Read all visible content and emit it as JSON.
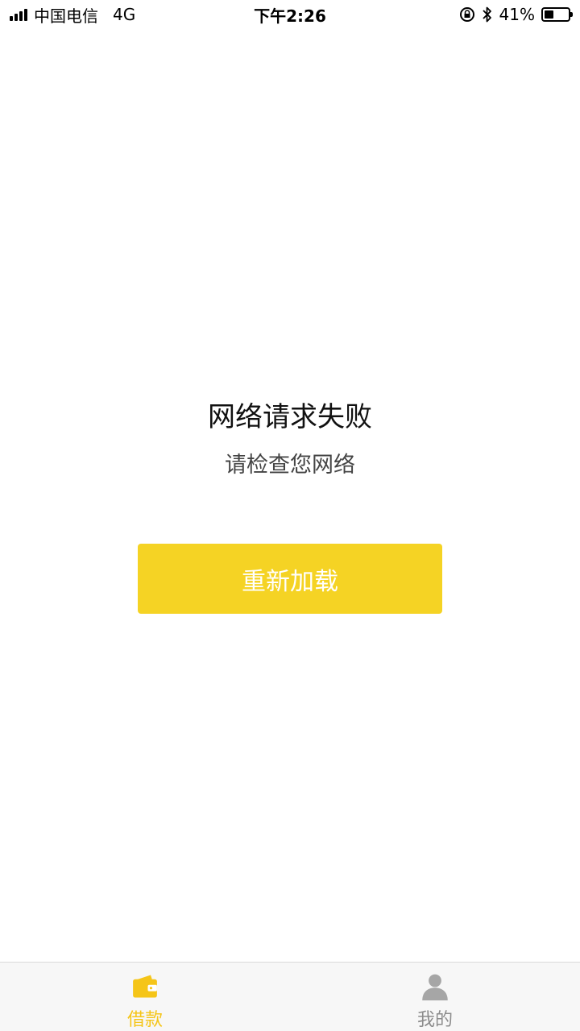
{
  "status_bar": {
    "carrier": "中国电信",
    "network": "4G",
    "time": "下午2:26",
    "battery_percent": "41%",
    "battery_level": 0.41,
    "icons": [
      "signal-icon",
      "rotation-lock-icon",
      "bluetooth-icon",
      "battery-icon"
    ]
  },
  "error": {
    "title": "网络请求失败",
    "subtitle": "请检查您网络",
    "reload_label": "重新加载"
  },
  "tabs": [
    {
      "label": "借款",
      "icon": "wallet-icon",
      "active": true
    },
    {
      "label": "我的",
      "icon": "person-icon",
      "active": false
    }
  ],
  "colors": {
    "accent": "#f5d324",
    "tab_active": "#f5c518",
    "tab_inactive": "#8c8c8c",
    "background": "#ffffff"
  }
}
